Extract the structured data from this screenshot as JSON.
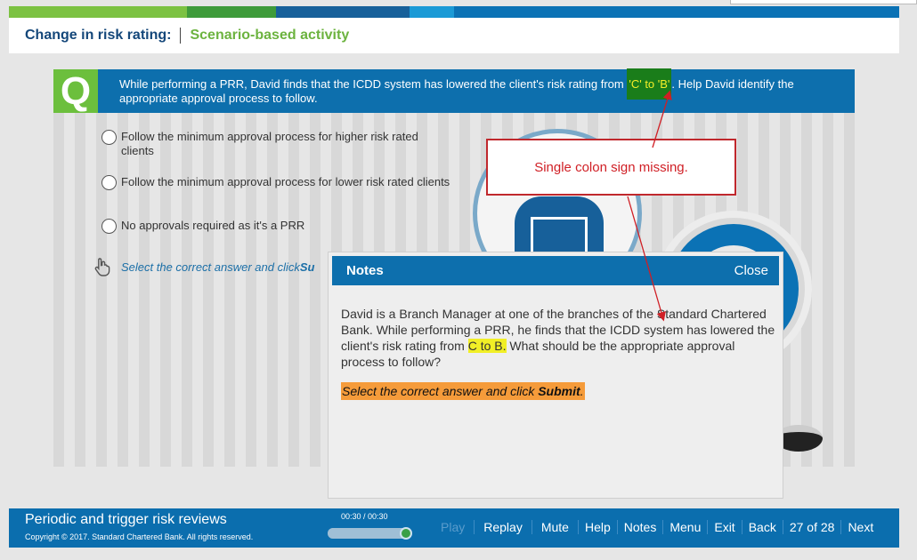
{
  "header": {
    "title": "Change in risk rating:",
    "subtitle": "Scenario-based activity"
  },
  "question": {
    "badge": "Q",
    "text_before": "While performing a PRR, David finds that the ICDD system has lowered the client's risk rating from ",
    "highlight": "'C' to 'B'",
    "text_after": ". Help David identify the appropriate approval process to follow."
  },
  "options": [
    {
      "label": "Follow the minimum approval process for higher risk rated clients"
    },
    {
      "label": "Follow the minimum approval process for lower risk rated clients"
    },
    {
      "label": "No approvals required as it's a PRR"
    }
  ],
  "instruction": {
    "text": "Select the correct answer and click ",
    "emphasis": "Su"
  },
  "callout": {
    "text": "Single colon sign missing."
  },
  "notes": {
    "title": "Notes",
    "close_label": "Close",
    "body_before": "David is a Branch Manager at one of the branches of the Standard Chartered Bank. While performing a PRR, he finds that the ICDD system has lowered the client's risk rating from ",
    "body_highlight": "C to B.",
    "body_after": " What should be the appropriate approval process to follow?",
    "instruction": "Select the correct answer and click ",
    "instruction_bold": "Submit",
    "instruction_end": "."
  },
  "footer": {
    "title": "Periodic and trigger risk reviews",
    "copyright": "Copyright © 2017. Standard Chartered Bank. All rights reserved.",
    "time": "00:30 / 00:30",
    "progress": 1.0,
    "buttons": {
      "play": "Play",
      "replay": "Replay",
      "mute": "Mute",
      "help": "Help",
      "notes": "Notes",
      "menu": "Menu",
      "exit": "Exit",
      "back": "Back",
      "counter": "27 of 28",
      "next": "Next"
    }
  },
  "colors": {
    "brand_blue": "#0b6eae",
    "brand_green": "#6cb33f",
    "callout_red": "#d01f25",
    "highlight_yellow": "#f1ef26",
    "highlight_orange": "#f59b3a"
  },
  "icons": {
    "hand": "hand-pointer-icon"
  }
}
